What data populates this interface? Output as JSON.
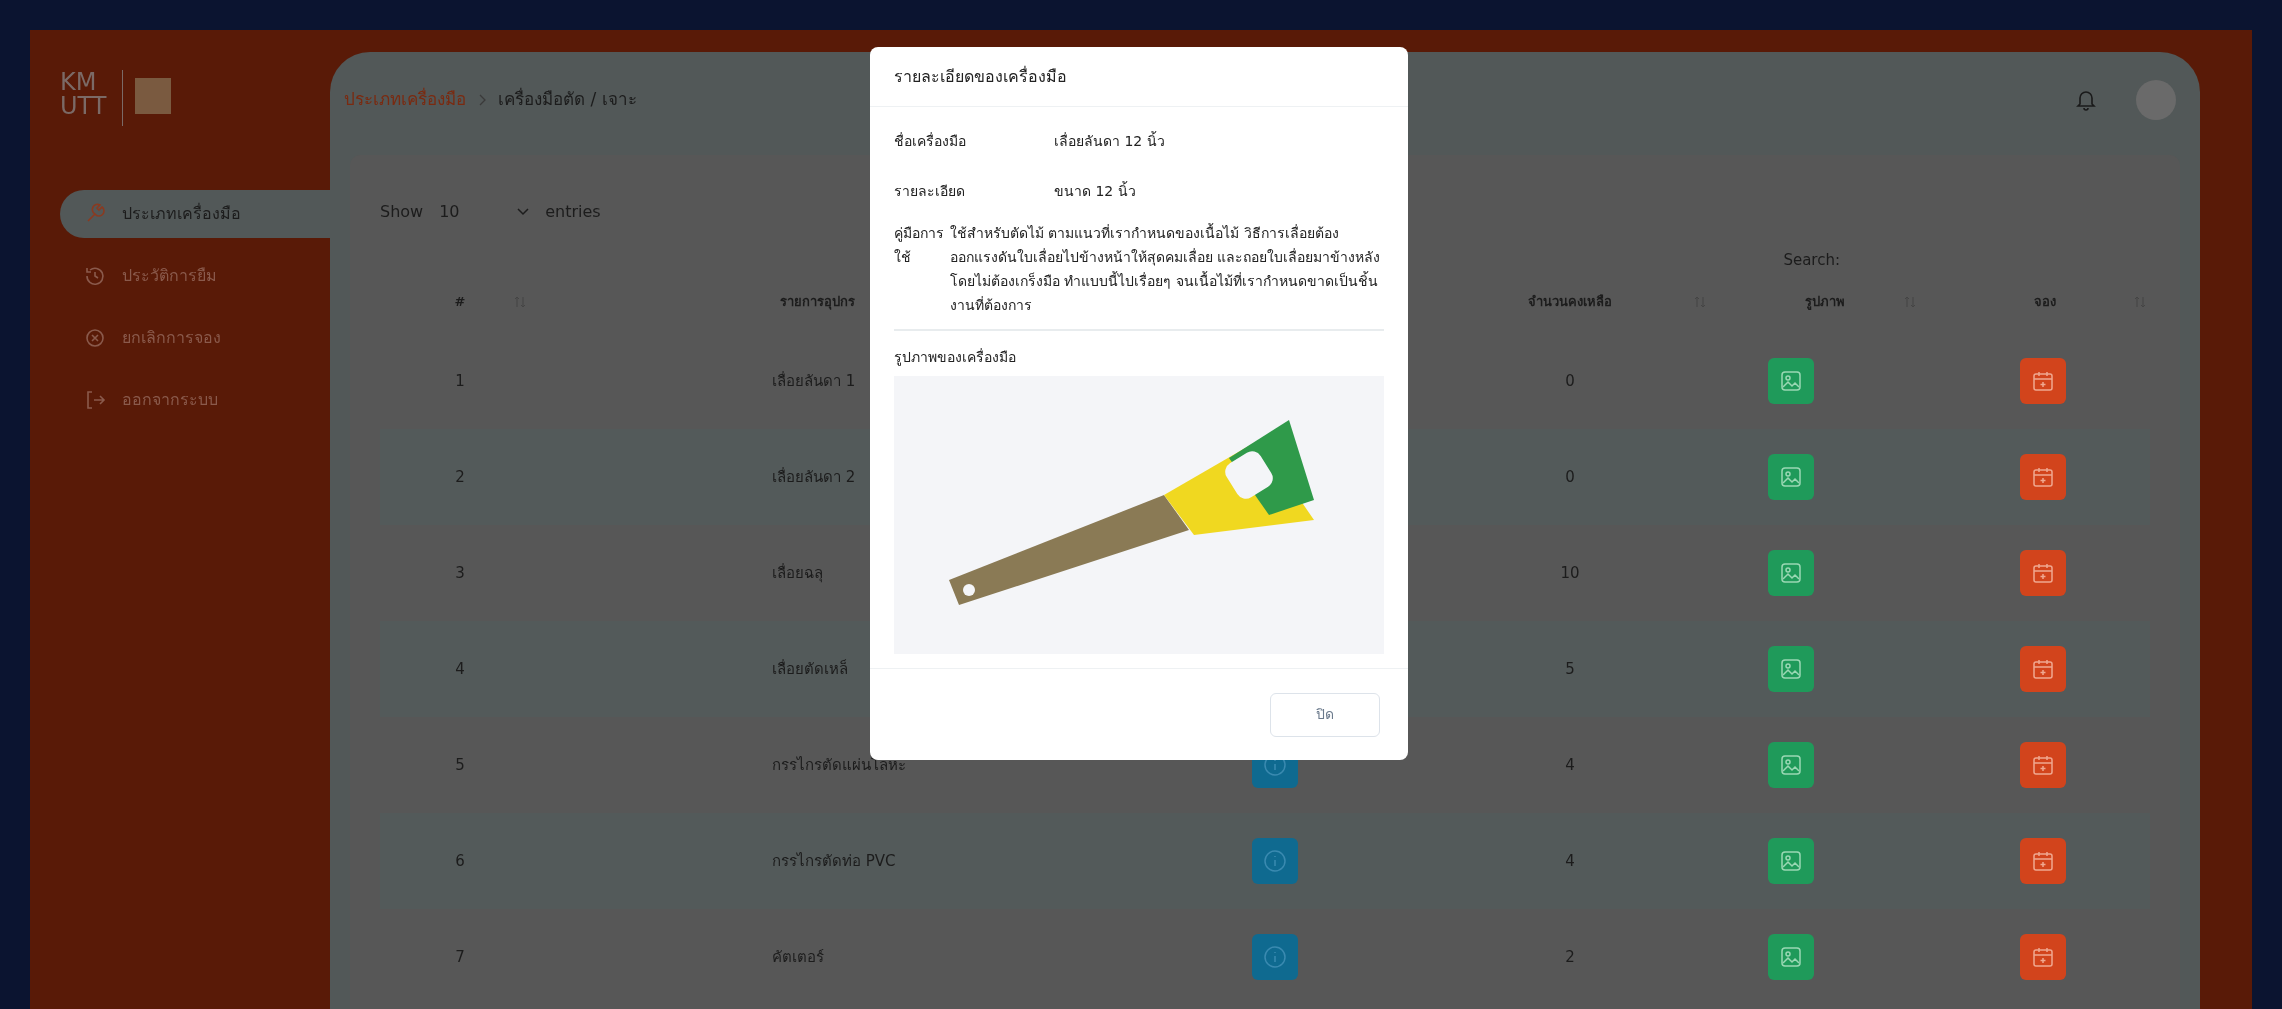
{
  "logo": {
    "lines": [
      "KM",
      "UTT"
    ]
  },
  "sidebar": {
    "items": [
      {
        "label": "ประเภทเครื่องมือ",
        "selected": true
      },
      {
        "label": "ประวัติการยืม",
        "selected": false
      },
      {
        "label": "ยกเลิกการจอง",
        "selected": false
      },
      {
        "label": "ออกจากระบบ",
        "selected": false
      }
    ]
  },
  "breadcrumb": [
    "ประเภทเครื่องมือ",
    "เครื่องมือตัด / เจาะ"
  ],
  "table_controls": {
    "show_label": "Show",
    "page_size": "10",
    "entries_label": "entries",
    "search_label": "Search:"
  },
  "table": {
    "columns": [
      {
        "label": "#",
        "sortable": true
      },
      {
        "label": "รายการอุปกร"
      },
      {},
      {
        "label": "จำนวนคงเหลือ",
        "sortable": true
      },
      {
        "label": "รูปภาพ",
        "sortable": true
      },
      {
        "label": "จอง",
        "sortable": true
      }
    ],
    "rows": [
      {
        "no": "1",
        "name": "เลื่อยลันดา 1",
        "remaining": "0"
      },
      {
        "no": "2",
        "name": "เลื่อยลันดา 2",
        "remaining": "0"
      },
      {
        "no": "3",
        "name": "เลื่อยฉลุ",
        "remaining": "10"
      },
      {
        "no": "4",
        "name": "เลื่อยตัดเหล็",
        "remaining": "5"
      },
      {
        "no": "5",
        "name": "กรรไกรตัดแผ่นโลหะ",
        "info_button": true,
        "remaining": "4"
      },
      {
        "no": "6",
        "name": "กรรไกรตัดท่อ PVC",
        "info_button": true,
        "remaining": "4"
      },
      {
        "no": "7",
        "name": "คัตเตอร์",
        "info_button": true,
        "remaining": "2"
      }
    ]
  },
  "modal": {
    "title": "รายละเอียดของเครื่องมือ",
    "fields": [
      {
        "label": "ชื่อเครื่องมือ",
        "value": "เลื่อยลันดา 12 นิ้ว",
        "kind": "wide"
      },
      {
        "label": "รายละเอียด",
        "value": "ขนาด 12 นิ้ว",
        "kind": "wide"
      },
      {
        "label": "คู่มือการใช้",
        "value": "ใช้สำหรับตัดไม้ ตามแนวที่เรากำหนดของเนื้อไม้ วิธีการเลื่อยต้องออกแรงดันใบเลื่อยไปข้างหน้าให้สุดคมเลื่อย และถอยใบเลื่อยมาข้างหลังโดยไม่ต้องเกร็งมือ ทำแบบนี้ไปเรื่อยๆ จนเนื้อไม้ที่เรากำหนดขาดเป็นชิ้นงานที่ต้องการ",
        "kind": "narrow"
      }
    ],
    "image_label": "รูปภาพของเครื่องมือ",
    "close_button": "ปิด"
  }
}
